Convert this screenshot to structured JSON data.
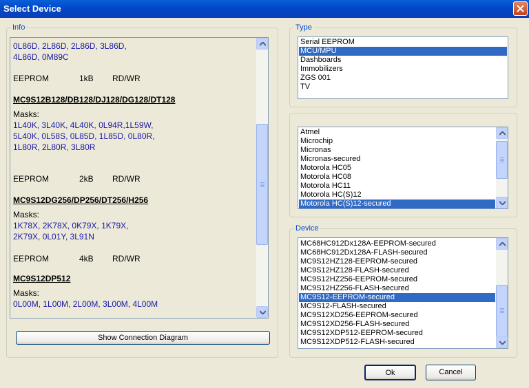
{
  "window": {
    "title": "Select Device"
  },
  "info": {
    "label": "Info",
    "lines": {
      "l1": "0L86D, 2L86D, 2L86D, 3L86D,",
      "l2": "4L86D, 0M89C",
      "eeprom_label": "EEPROM",
      "row1_size": "1kB",
      "row1_mode": "RD/WR",
      "h1": "MC9S12B128/DB128/DJ128/DG128/DT128",
      "masks1_label": "Masks:",
      "m1a": "1L40K, 3L40K, 4L40K, 0L94R,1L59W,",
      "m1b": "5L40K, 0L58S, 0L85D, 1L85D, 0L80R,",
      "m1c": "1L80R, 2L80R, 3L80R",
      "row2_size": "2kB",
      "row2_mode": "RD/WR",
      "h2": "MC9S12DG256/DP256/DT256/H256",
      "masks2_label": "Masks:",
      "m2a": "1K78X, 2K78X, 0K79X, 1K79X,",
      "m2b": "2K79X, 0L01Y, 3L91N",
      "row3_size": "4kB",
      "row3_mode": "RD/WR",
      "h3": "MC9S12DP512",
      "masks3_label": "Masks:",
      "m3a": "0L00M, 1L00M, 2L00M,  3L00M, 4L00M"
    }
  },
  "show_connection_diagram": "Show Connection Diagram",
  "type": {
    "label": "Type",
    "items": [
      "Serial EEPROM",
      "MCU/MPU",
      "Dashboards",
      "Immobilizers",
      "ZGS 001",
      "TV"
    ],
    "selected": "MCU/MPU"
  },
  "manufacturer": {
    "items": [
      "Atmel",
      "Microchip",
      "Micronas",
      "Micronas-secured",
      "Motorola HC05",
      "Motorola HC08",
      "Motorola HC11",
      "Motorola HC(S)12",
      "Motorola HC(S)12-secured"
    ],
    "selected": "Motorola HC(S)12-secured"
  },
  "device": {
    "label": "Device",
    "items": [
      "MC68HC912Dx128A-EEPROM-secured",
      "MC68HC912Dx128A-FLASH-secured",
      "MC9S12HZ128-EEPROM-secured",
      "MC9S12HZ128-FLASH-secured",
      "MC9S12HZ256-EEPROM-secured",
      "MC9S12HZ256-FLASH-secured",
      "MC9S12-EEPROM-secured",
      "MC9S12-FLASH-secured",
      "MC9S12XD256-EEPROM-secured",
      "MC9S12XD256-FLASH-secured",
      "MC9S12XDP512-EEPROM-secured",
      "MC9S12XDP512-FLASH-secured"
    ],
    "selected": "MC9S12-EEPROM-secured"
  },
  "buttons": {
    "ok": "Ok",
    "cancel": "Cancel"
  },
  "icons": {
    "close": "close-icon",
    "scroll_up": "arrow-up-icon",
    "scroll_down": "arrow-down-icon"
  },
  "colors": {
    "titlebar": "#0a5fd8",
    "selection": "#316ac5",
    "info_text_blue": "#1a1aa6",
    "group_label": "#0046d5"
  }
}
